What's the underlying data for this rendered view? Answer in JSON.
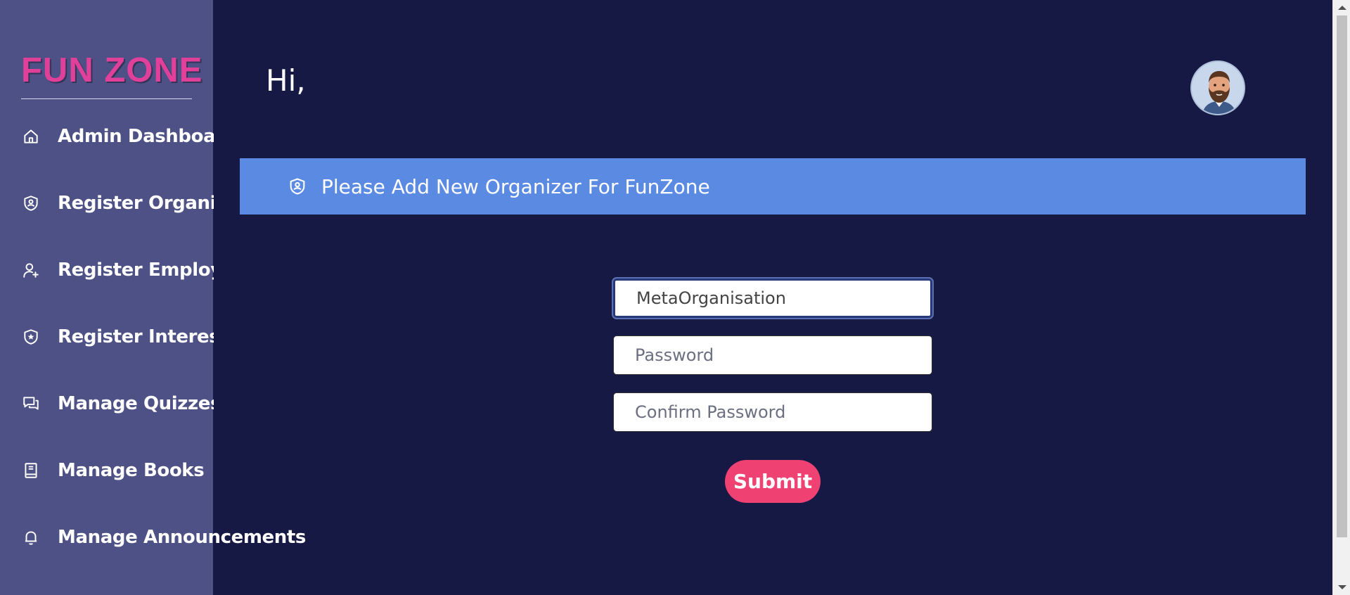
{
  "brand": "FUN ZONE",
  "sidebar": {
    "items": [
      {
        "label": "Admin Dashboard",
        "icon": "home-icon"
      },
      {
        "label": "Register Organizer",
        "icon": "shield-user-icon"
      },
      {
        "label": "Register Employee",
        "icon": "user-add-icon"
      },
      {
        "label": "Register Interest",
        "icon": "shield-star-icon"
      },
      {
        "label": "Manage Quizzes",
        "icon": "chat-icon"
      },
      {
        "label": "Manage Books",
        "icon": "book-icon"
      },
      {
        "label": "Manage Announcements",
        "icon": "bell-icon"
      }
    ]
  },
  "header": {
    "greeting": "Hi,",
    "avatar_icon": "bearded-man-avatar"
  },
  "banner": {
    "text": "Please Add New Organizer For FunZone",
    "icon": "shield-user-icon"
  },
  "form": {
    "name_value": "MetaOrganisation",
    "password_placeholder": "Password",
    "confirm_placeholder": "Confirm Password",
    "submit_label": "Submit"
  },
  "colors": {
    "sidebar_bg": "#4d5185",
    "main_bg": "#161944",
    "brand": "#e0409a",
    "banner_bg": "#5b8ae3",
    "submit_bg": "#ef4272"
  }
}
